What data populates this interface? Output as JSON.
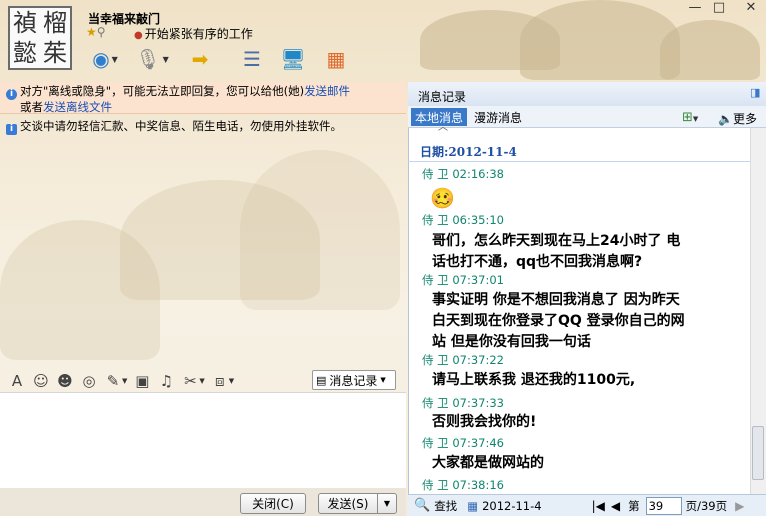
{
  "window": {
    "logo_chars": [
      "禎",
      "榴",
      "懿",
      "茱"
    ],
    "contact_name": "当幸福来敲门",
    "signature": "开始紧张有序的工作",
    "controls": {
      "minimize": "—",
      "maximize": "□",
      "close": "✕"
    }
  },
  "toolbar": {
    "icons": [
      "webcam-icon",
      "microphone-icon",
      "send-file-icon",
      "app-list-icon",
      "remote-desktop-icon",
      "calendar-icon"
    ]
  },
  "chat": {
    "notice_line1_a": "对方\"离线或隐身\"，可能无法立即回复，您可以给他(她)",
    "notice_line1_link": "发送邮件",
    "notice_line2_a": "或者",
    "notice_line2_link": "发送离线文件",
    "warning": "交谈中请勿轻信汇款、中奖信息、陌生电话，勿使用外挂软件。"
  },
  "format_bar": {
    "history_button": "消息记录"
  },
  "footer_buttons": {
    "close": "关闭(C)",
    "send": "发送(S)",
    "send_dropdown": "▼"
  },
  "history": {
    "title": "消息记录",
    "tabs": [
      "本地消息",
      "漫游消息"
    ],
    "more": "更多",
    "date_label": "日期:2012-11-4",
    "messages": [
      {
        "sender": "侍 卫",
        "time": "02:16:38",
        "text": "🥴"
      },
      {
        "sender": "侍 卫",
        "time": "06:35:10",
        "lines": [
          "哥们，怎么昨天到现在马上24小时了 电",
          "话也打不通，qq也不回我消息啊?"
        ]
      },
      {
        "sender": "侍 卫",
        "time": "07:37:01",
        "lines": [
          "事实证明 你是不想回我消息了 因为昨天",
          "白天到现在你登录了QQ 登录你自己的网",
          "站 但是你没有回我一句话"
        ]
      },
      {
        "sender": "侍 卫",
        "time": "07:37:22",
        "lines": [
          "请马上联系我 退还我的1100元,"
        ]
      },
      {
        "sender": "侍 卫",
        "time": "07:37:33",
        "lines": [
          "否则我会找你的!"
        ]
      },
      {
        "sender": "侍 卫",
        "time": "07:37:46",
        "lines": [
          "大家都是做网站的"
        ]
      },
      {
        "sender": "侍 卫",
        "time": "07:38:16",
        "lines": []
      }
    ],
    "footer": {
      "search": "查找",
      "date": "2012-11-4",
      "page_prefix": "第",
      "page_value": "39",
      "page_suffix": "页/39页"
    }
  }
}
